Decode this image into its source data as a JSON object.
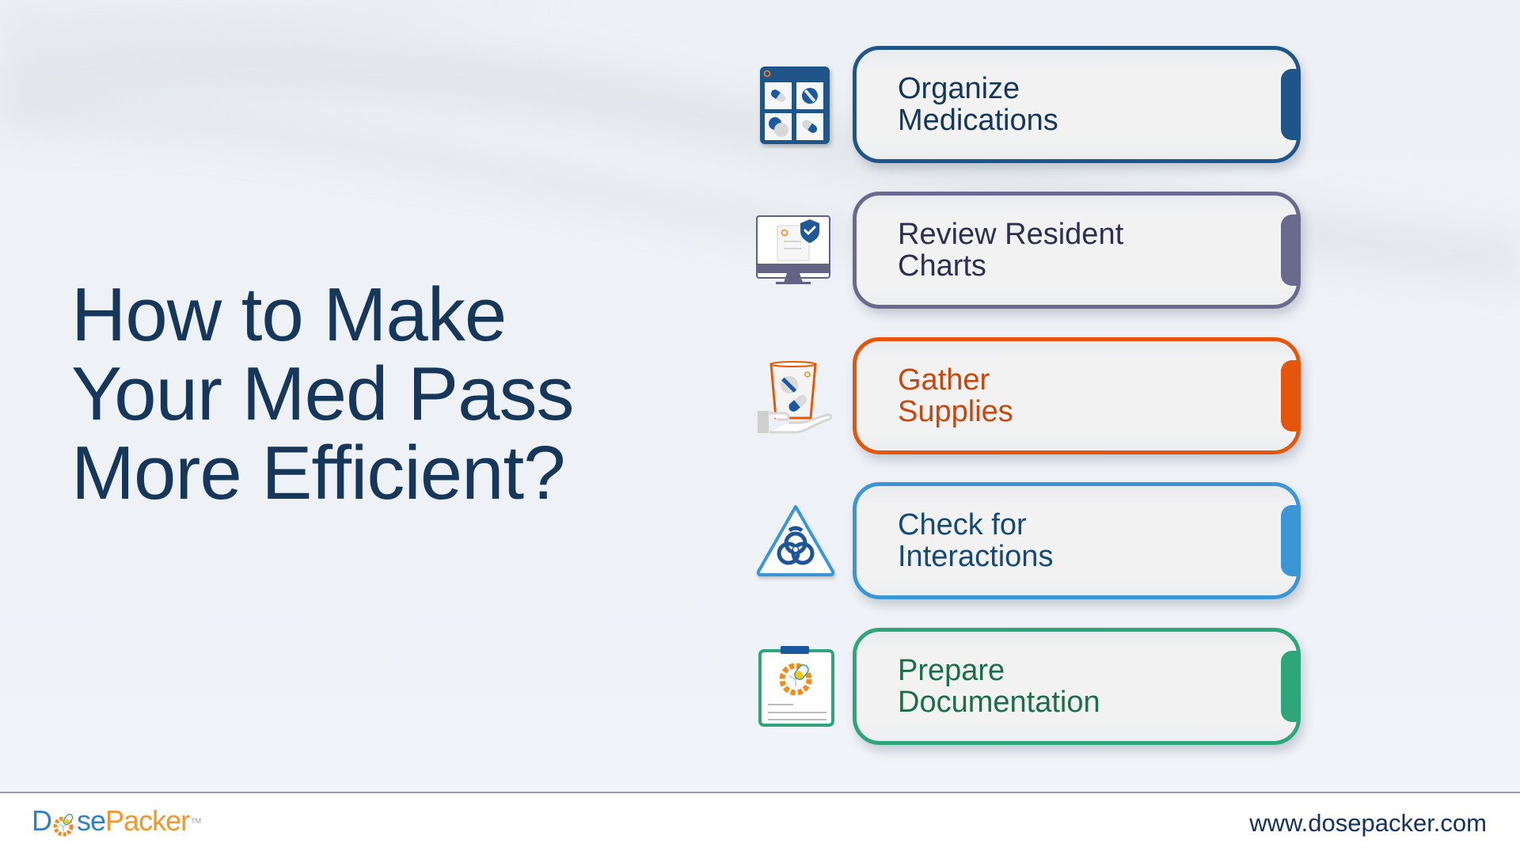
{
  "title": {
    "lines": [
      "How to Make",
      "Your Med Pass",
      "More Efficient?"
    ],
    "color": "#16365a"
  },
  "steps": [
    {
      "lines": [
        "Organize",
        "Medications"
      ],
      "icon": "pill-organizer-icon",
      "border_color": "#1f5588",
      "text_color": "#16365a"
    },
    {
      "lines": [
        "Review Resident",
        "Charts"
      ],
      "icon": "monitor-chart-shield-icon",
      "border_color": "#6a6a8e",
      "text_color": "#2e2e50"
    },
    {
      "lines": [
        "Gather",
        "Supplies"
      ],
      "icon": "hand-pill-cup-icon",
      "border_color": "#e5560c",
      "text_color": "#c4480f"
    },
    {
      "lines": [
        "Check for",
        "Interactions"
      ],
      "icon": "biohazard-warning-icon",
      "border_color": "#3b96d6",
      "text_color": "#154a78"
    },
    {
      "lines": [
        "Prepare",
        "Documentation"
      ],
      "icon": "clipboard-document-icon",
      "border_color": "#2ea57a",
      "text_color": "#1b6e4c"
    }
  ],
  "footer": {
    "logo": {
      "part1": "D",
      "part2": "se",
      "part3": "Packer",
      "tm": "TM"
    },
    "url": "www.dosepacker.com"
  }
}
